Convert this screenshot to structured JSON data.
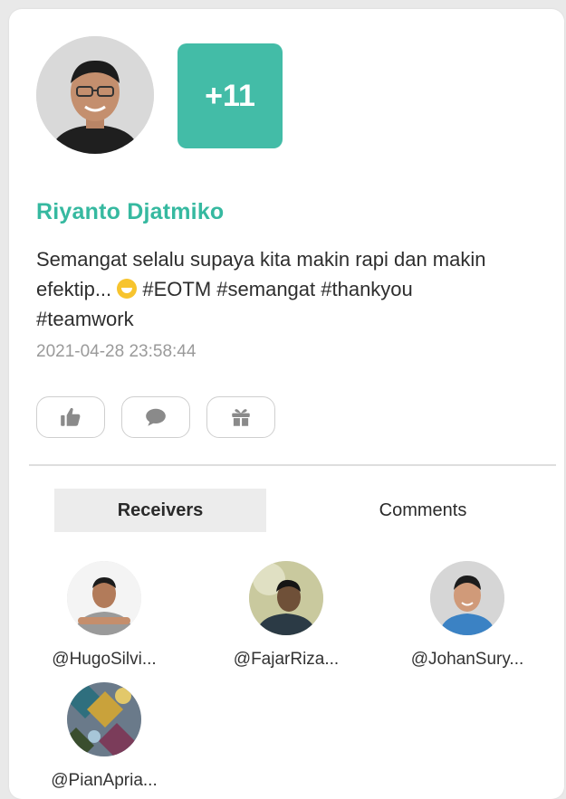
{
  "post": {
    "extra_receivers_badge": "+11",
    "sender_name": "Riyanto Djatmiko",
    "message_part1": "Semangat selalu supaya kita makin rapi dan makin efektip... ",
    "message_part2": " #EOTM #semangat #thankyou #teamwork",
    "timestamp": "2021-04-28 23:58:44"
  },
  "actions": [
    {
      "icon": "thumbs-up-icon"
    },
    {
      "icon": "comment-icon"
    },
    {
      "icon": "gift-icon"
    }
  ],
  "tabs": [
    {
      "label": "Receivers",
      "active": true
    },
    {
      "label": "Comments",
      "active": false
    }
  ],
  "receivers": [
    {
      "handle": "@HugoSilvi..."
    },
    {
      "handle": "@FajarRiza..."
    },
    {
      "handle": "@JohanSury..."
    },
    {
      "handle": "@PianApria..."
    }
  ],
  "colors": {
    "accent": "#43bca7",
    "name": "#36b9a0",
    "timestamp": "#9a9a9a",
    "tab_active_bg": "#ececec"
  }
}
